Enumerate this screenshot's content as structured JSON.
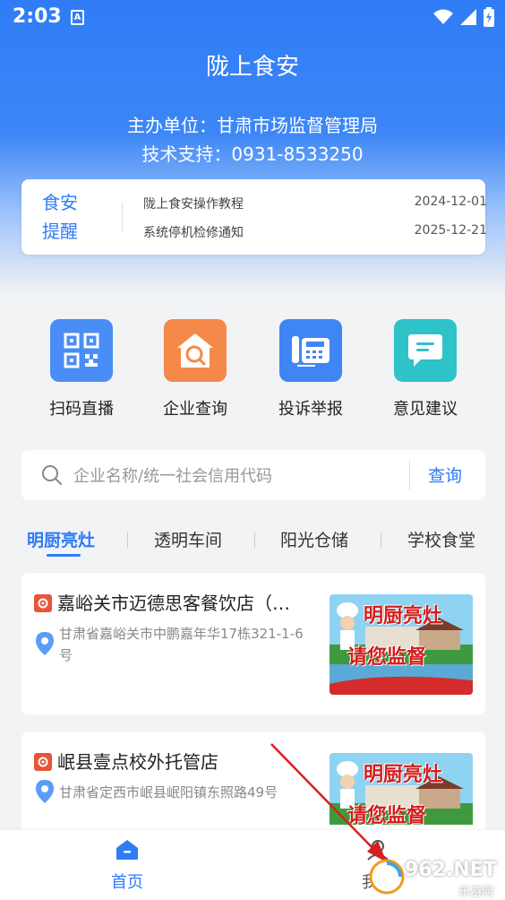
{
  "status_bar": {
    "time": "2:03",
    "a_badge": "A"
  },
  "header": {
    "title": "陇上食安",
    "sponsor_line": "主办单位：甘肃市场监督管理局",
    "support_line": "技术支持：0931-8533250"
  },
  "notice": {
    "label_line1": "食安",
    "label_line2": "提醒",
    "items": [
      {
        "title": "陇上食安操作教程",
        "date": "2024-12-01"
      },
      {
        "title": "系统停机检修通知",
        "date": "2025-12-21"
      }
    ]
  },
  "quick_actions": [
    {
      "label": "扫码直播",
      "icon": "qr-code-icon",
      "color": "#4a8df6"
    },
    {
      "label": "企业查询",
      "icon": "house-search-icon",
      "color": "#f5894a"
    },
    {
      "label": "投诉举报",
      "icon": "fax-phone-icon",
      "color": "#3f86f4"
    },
    {
      "label": "意见建议",
      "icon": "chat-bubble-icon",
      "color": "#2ec2c9"
    }
  ],
  "search": {
    "placeholder": "企业名称/统一社会信用代码",
    "button_label": "查询"
  },
  "tabs": [
    {
      "label": "明厨亮灶",
      "active": true
    },
    {
      "label": "透明车间",
      "active": false
    },
    {
      "label": "阳光仓储",
      "active": false
    },
    {
      "label": "学校食堂",
      "active": false
    }
  ],
  "listings": [
    {
      "name": "嘉峪关市迈德思客餐饮店（…",
      "address": "甘肃省嘉峪关市中鹏嘉年华17栋321-1-6号",
      "thumb_line1": "明厨亮灶",
      "thumb_line2": "请您监督"
    },
    {
      "name": "岷县壹点校外托管店",
      "address": "甘肃省定西市岷县岷阳镇东照路49号",
      "thumb_line1": "明厨亮灶",
      "thumb_line2": "请您监督"
    }
  ],
  "bottom_nav": [
    {
      "label": "首页",
      "active": true,
      "icon": "home-icon"
    },
    {
      "label": "我的",
      "active": false,
      "icon": "profile-icon"
    }
  ],
  "watermark": {
    "text_big": "962.NET",
    "text_small": "乐游网"
  },
  "colors": {
    "brand_blue": "#2f7cf6",
    "logo_red": "#e8553a"
  }
}
